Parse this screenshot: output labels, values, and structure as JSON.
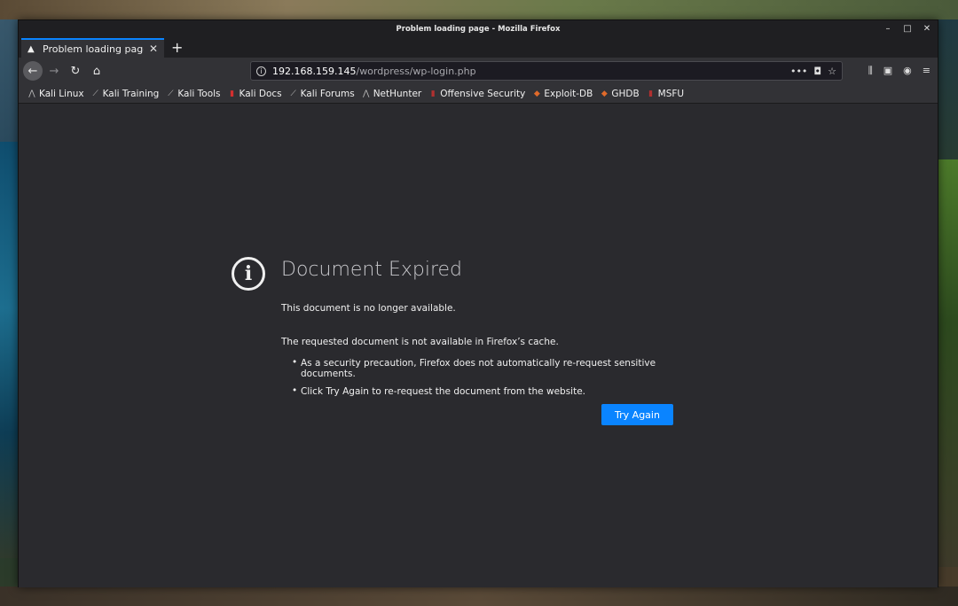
{
  "window": {
    "title": "Problem loading page - Mozilla Firefox",
    "controls": [
      "–",
      "□",
      "✕"
    ]
  },
  "tab": {
    "label": "Problem loading page",
    "close": "✕",
    "new_tab": "+"
  },
  "nav": {
    "back_icon": "←",
    "forward_icon": "→",
    "reload_icon": "↻",
    "home_icon": "⌂"
  },
  "urlbar": {
    "host": "192.168.159.145",
    "path": "/wordpress/wp-login.php",
    "more_icon": "•••",
    "pocket_icon": "◘",
    "star_icon": "☆"
  },
  "toolbar_right": {
    "library_icon": "⫼",
    "sidebar_icon": "▣",
    "account_icon": "◉",
    "menu_icon": "≡"
  },
  "bookmarks": [
    {
      "label": "Kali Linux",
      "icon": "⋀",
      "color": "#bbbbbb"
    },
    {
      "label": "Kali Training",
      "icon": "⟋",
      "color": "#bbbbbb"
    },
    {
      "label": "Kali Tools",
      "icon": "⟋",
      "color": "#bbbbbb"
    },
    {
      "label": "Kali Docs",
      "icon": "▮",
      "color": "#d42f2f"
    },
    {
      "label": "Kali Forums",
      "icon": "⟋",
      "color": "#bbbbbb"
    },
    {
      "label": "NetHunter",
      "icon": "⋀",
      "color": "#bbbbbb"
    },
    {
      "label": "Offensive Security",
      "icon": "▮",
      "color": "#b03030"
    },
    {
      "label": "Exploit-DB",
      "icon": "◆",
      "color": "#e06a2a"
    },
    {
      "label": "GHDB",
      "icon": "◆",
      "color": "#e06a2a"
    },
    {
      "label": "MSFU",
      "icon": "▮",
      "color": "#b03030"
    }
  ],
  "error": {
    "icon": "i",
    "title": "Document Expired",
    "summary": "This document is no longer available.",
    "detail": "The requested document is not available in Firefox’s cache.",
    "bullets": [
      "As a security precaution, Firefox does not automatically re-request sensitive documents.",
      "Click Try Again to re-request the document from the website."
    ],
    "button_label": "Try Again"
  },
  "colors": {
    "accent": "#0a84ff",
    "page_bg": "#2a2a2e",
    "toolbar_bg": "#323236"
  }
}
